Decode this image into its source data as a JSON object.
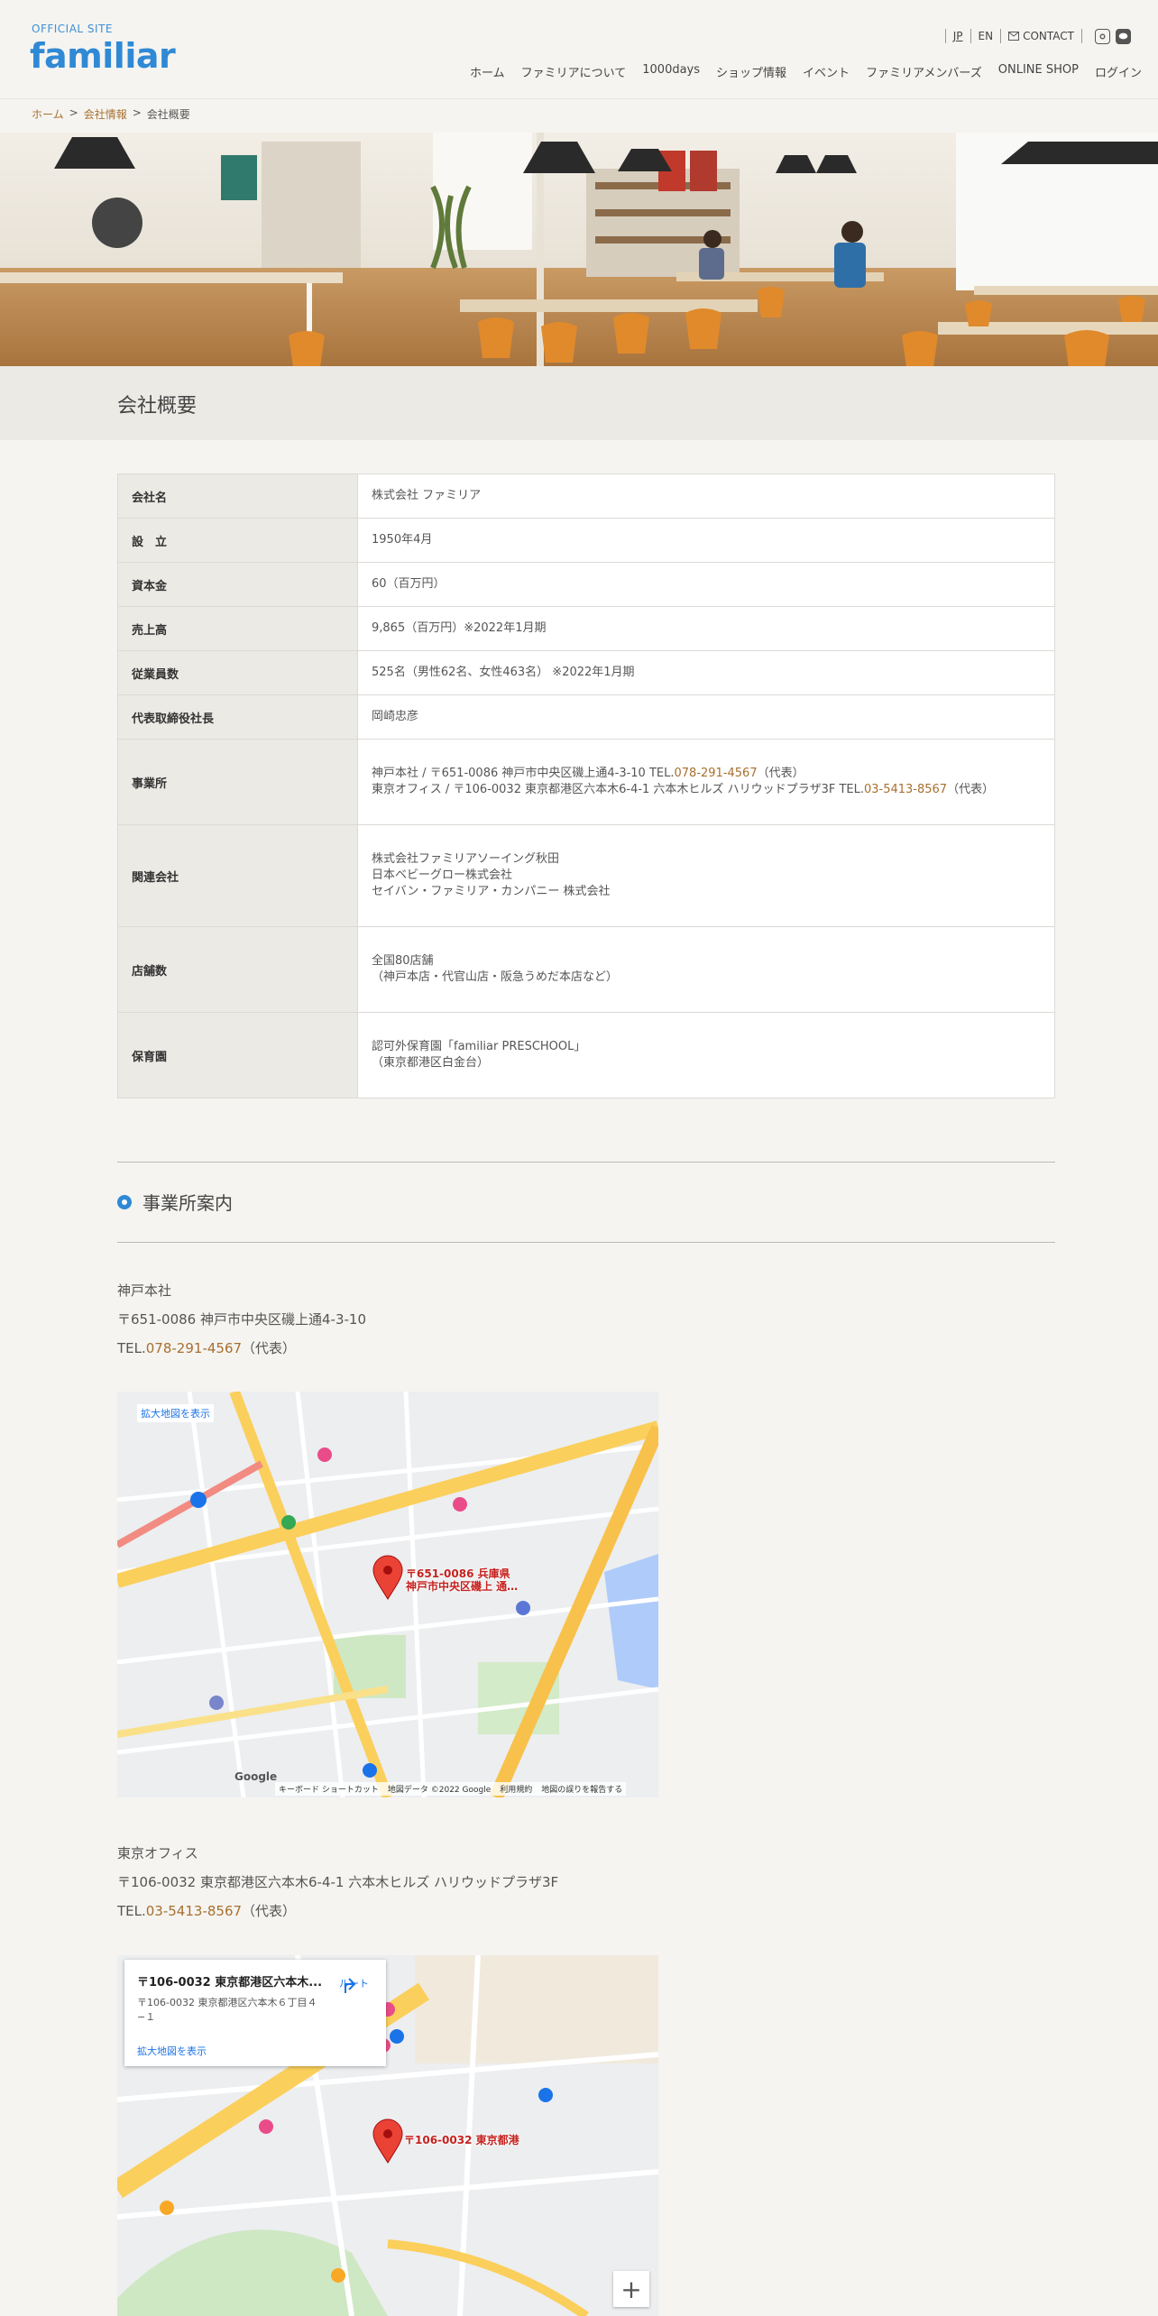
{
  "header": {
    "site_label": "OFFICIAL SITE",
    "logo": "familiar",
    "lang_jp": "JP",
    "lang_en": "EN",
    "contact": "CONTACT",
    "nav": [
      "ホーム",
      "ファミリアについて",
      "1000days",
      "ショップ情報",
      "イベント",
      "ファミリアメンバーズ",
      "ONLINE SHOP",
      "ログイン"
    ]
  },
  "breadcrumb": {
    "home": "ホーム",
    "company": "会社情報",
    "current": "会社概要"
  },
  "page_title": "会社概要",
  "company": {
    "rows": [
      {
        "label": "会社名",
        "value": "株式会社 ファミリア"
      },
      {
        "label": "設　立",
        "value": "1950年4月"
      },
      {
        "label": "資本金",
        "value": "60（百万円）"
      },
      {
        "label": "売上高",
        "value": "9,865（百万円）※2022年1月期"
      },
      {
        "label": "従業員数",
        "value": "525名（男性62名、女性463名） ※2022年1月期"
      },
      {
        "label": "代表取締役社長",
        "value": "岡崎忠彦"
      }
    ],
    "office_label": "事業所",
    "office_line1_pre": "神戸本社 / 〒651-0086 神戸市中央区磯上通4-3-10 TEL.",
    "office_line1_tel": "078-291-4567",
    "office_line1_post": "（代表）",
    "office_line2_pre": "東京オフィス / 〒106-0032 東京都港区六本木6-4-1 六本木ヒルズ ハリウッドプラザ3F TEL.",
    "office_line2_tel": "03-5413-8567",
    "office_line2_post": "（代表）",
    "affiliates_label": "関連会社",
    "affiliates": [
      "株式会社ファミリアソーイング秋田",
      "日本ベビーグロー株式会社",
      "セイバン・ファミリア・カンパニー 株式会社"
    ],
    "stores_label": "店舗数",
    "stores": [
      "全国80店舗",
      "（神戸本店・代官山店・阪急うめだ本店など）"
    ],
    "nursery_label": "保育園",
    "nursery": [
      "認可外保育園「familiar PRESCHOOL」",
      "（東京都港区白金台）"
    ]
  },
  "section": {
    "title": "事業所案内"
  },
  "kobe": {
    "name": "神戸本社",
    "address": "〒651-0086 神戸市中央区磯上通4-3-10",
    "tel_pre": "TEL.",
    "tel": "078-291-4567",
    "tel_post": "（代表）",
    "map_link": "拡大地図を表示",
    "pin_line1": "〒651-0086 兵庫県",
    "pin_line2": "神戸市中央区磯上 通…",
    "map_footer": [
      "キーボード ショートカット",
      "地図データ ©2022 Google",
      "利用規約",
      "地図の誤りを報告する"
    ],
    "google": "Google"
  },
  "tokyo": {
    "name": "東京オフィス",
    "address": "〒106-0032 東京都港区六本木6-4-1 六本木ヒルズ ハリウッドプラザ3F",
    "tel_pre": "TEL.",
    "tel": "03-5413-8567",
    "tel_post": "（代表）",
    "popup_title": "〒106-0032 東京都港区六本木...",
    "popup_address": "〒106-0032 東京都港区六本木６丁目４−１",
    "popup_route": "ルート",
    "map_link": "拡大地図を表示",
    "pin_label": "〒106-0032 東京都港",
    "zoom": "+"
  },
  "colors": {
    "brand_blue": "#2f89d5",
    "link_brown": "#a86f2e",
    "bg": "#f5f4f1"
  }
}
